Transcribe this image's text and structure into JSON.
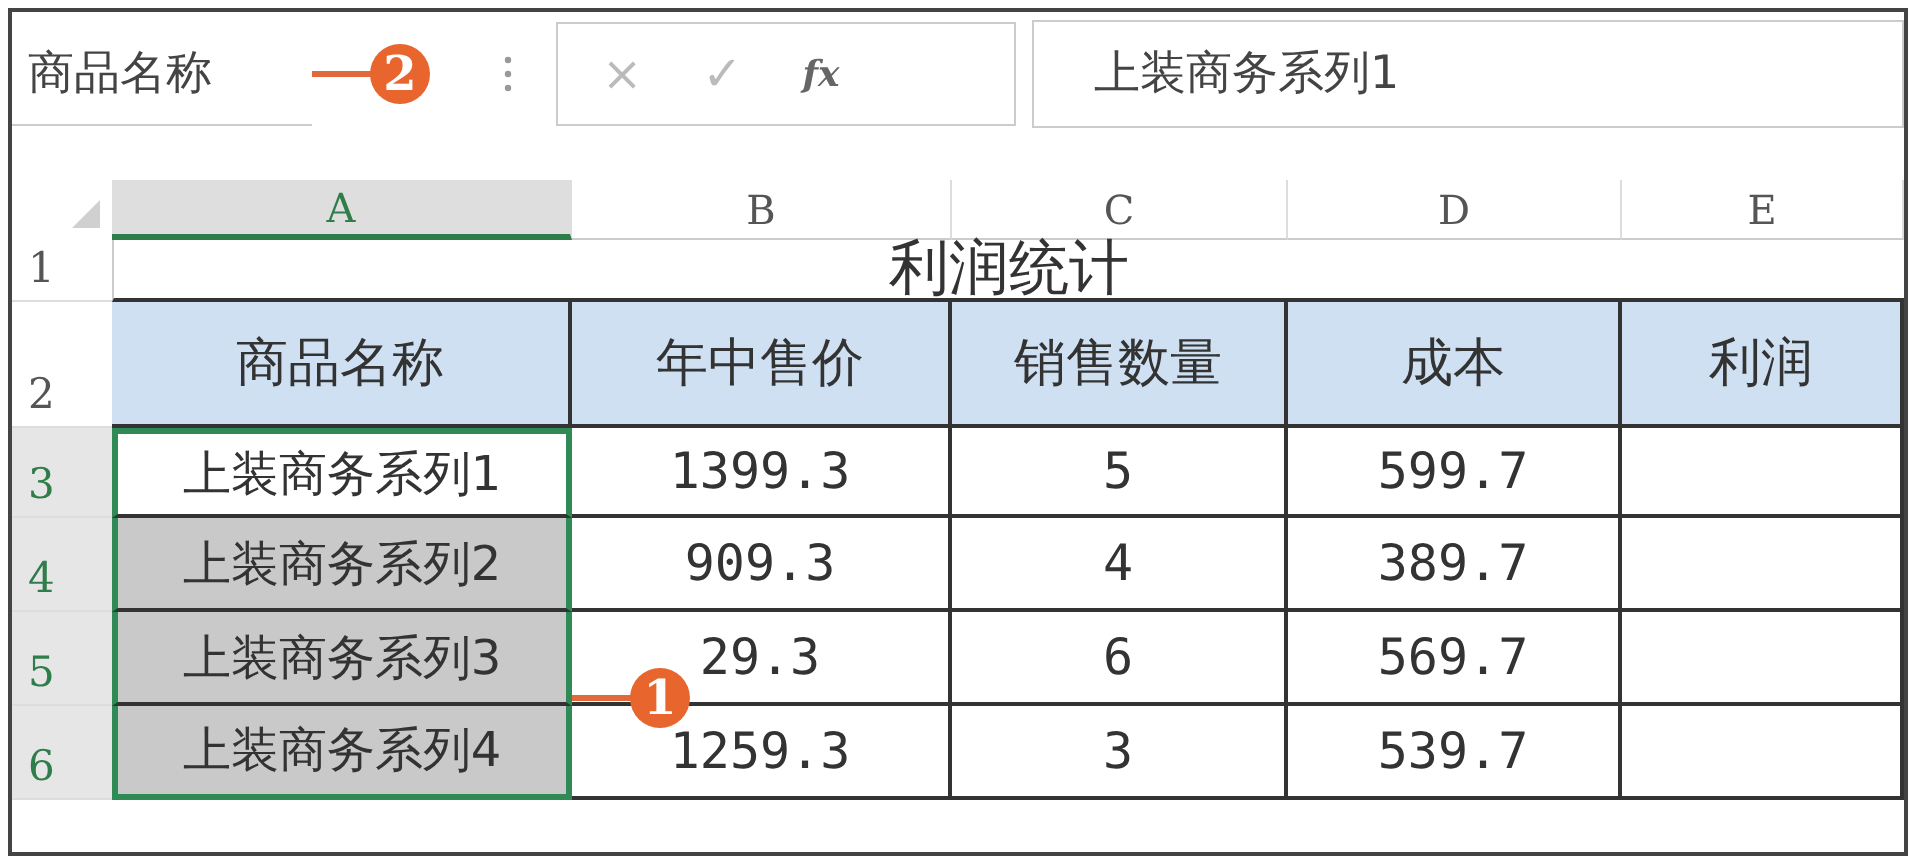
{
  "name_box": {
    "value": "商品名称"
  },
  "formula_bar": {
    "cancel": "×",
    "enter": "✓",
    "function": "fx",
    "value": "上装商务系列1"
  },
  "columns": [
    {
      "label": "A",
      "selected": true
    },
    {
      "label": "B",
      "selected": false
    },
    {
      "label": "C",
      "selected": false
    },
    {
      "label": "D",
      "selected": false
    },
    {
      "label": "E",
      "selected": false
    }
  ],
  "title_row": {
    "number": "1",
    "title": "利润统计"
  },
  "header_row": {
    "number": "2",
    "cells": [
      "商品名称",
      "年中售价",
      "销售数量",
      "成本",
      "利润"
    ]
  },
  "rows": [
    {
      "number": "3",
      "selected": true,
      "active": true,
      "cells": [
        "上装商务系列1",
        "1399.3",
        "5",
        "599.7"
      ]
    },
    {
      "number": "4",
      "selected": true,
      "active": false,
      "cells": [
        "上装商务系列2",
        "909.3",
        "4",
        "389.7"
      ]
    },
    {
      "number": "5",
      "selected": true,
      "active": false,
      "cells": [
        "上装商务系列3",
        "29.3",
        "6",
        "569.7"
      ]
    },
    {
      "number": "6",
      "selected": true,
      "active": false,
      "cells": [
        "上装商务系列4",
        "1259.3",
        "3",
        "539.7"
      ]
    }
  ],
  "callouts": [
    {
      "number": "2"
    },
    {
      "number": "1"
    }
  ]
}
